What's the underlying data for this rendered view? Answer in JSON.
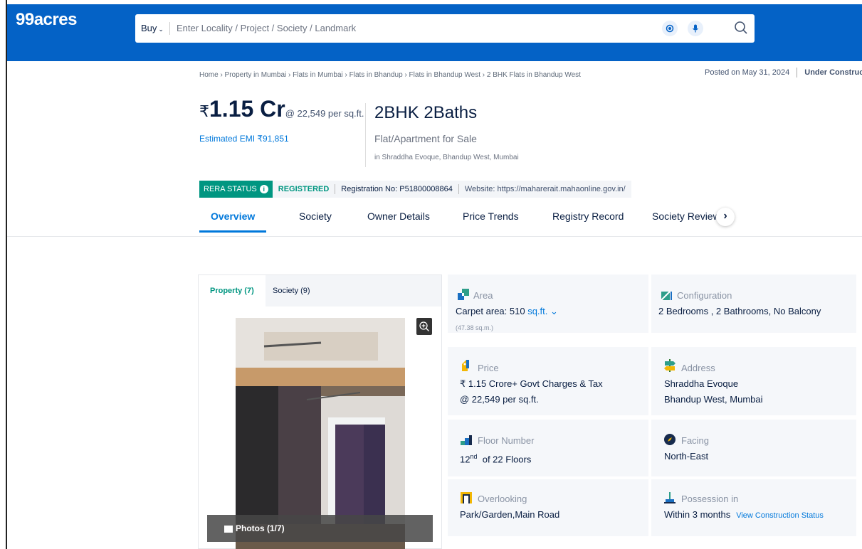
{
  "header": {
    "logo": "99acres",
    "buy_label": "Buy",
    "search_placeholder": "Enter Locality / Project / Society / Landmark"
  },
  "breadcrumb": "Home › Property in Mumbai › Flats in Mumbai › Flats in Bhandup › Flats in Bhandup West › 2 BHK Flats in Bhandup West",
  "posted": {
    "date": "Posted on May 31, 2024",
    "status": "Under Construction"
  },
  "listing": {
    "currency": "₹",
    "price": "1.15 Cr",
    "per_sqft": "@ 22,549 per sq.ft.",
    "emi": "Estimated EMI ₹91,851",
    "title": "2BHK 2Baths",
    "type": "Flat/Apartment for Sale",
    "location": "in Shraddha Evoque, Bhandup West, Mumbai"
  },
  "rera": {
    "status_label": "RERA STATUS",
    "registered": "REGISTERED",
    "registration_label": "Registration No:",
    "registration_no": "P51800008864",
    "website": "Website: https://maharerait.mahaonline.gov.in/"
  },
  "tabs": [
    "Overview",
    "Society",
    "Owner Details",
    "Price Trends",
    "Registry Record",
    "Society Reviews"
  ],
  "gallery": {
    "tab_property": "Property (7)",
    "tab_society": "Society (9)",
    "photos_label": "Photos (1/7)"
  },
  "details": {
    "area": {
      "label": "Area",
      "value": "Carpet area: 510",
      "unit": "sq.ft.",
      "sub": "(47.38 sq.m.)"
    },
    "configuration": {
      "label": "Configuration",
      "value": "2 Bedrooms , 2 Bathrooms, No Balcony"
    },
    "price": {
      "label": "Price",
      "line1": "₹ 1.15 Crore+ Govt Charges & Tax",
      "line2": "@ 22,549 per sq.ft."
    },
    "address": {
      "label": "Address",
      "line1": "Shraddha Evoque",
      "line2": "Bhandup West, Mumbai"
    },
    "floor": {
      "label": "Floor Number",
      "floor": "12",
      "suffix": "nd",
      "of": "of 22 Floors"
    },
    "facing": {
      "label": "Facing",
      "value": "North-East"
    },
    "overlooking": {
      "label": "Overlooking",
      "value": "Park/Garden,Main Road"
    },
    "possession": {
      "label": "Possession in",
      "value": "Within 3 months",
      "link": "View Construction Status"
    }
  },
  "colors": {
    "brand_blue": "#0462c6",
    "link_blue": "#0078db",
    "rera_green": "#009681"
  }
}
